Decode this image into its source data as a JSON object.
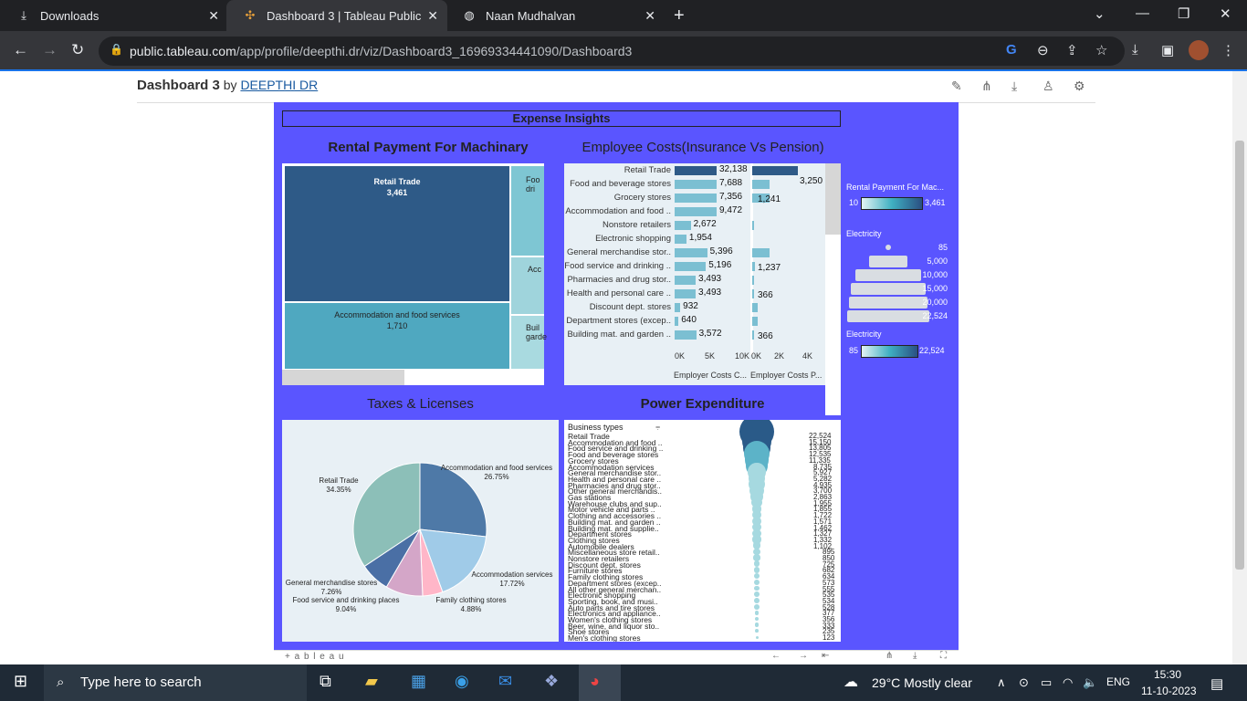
{
  "browser": {
    "tabs": [
      {
        "label": "Downloads",
        "icon": "download-icon"
      },
      {
        "label": "Dashboard 3 | Tableau Public",
        "icon": "tableau-icon"
      },
      {
        "label": "Naan Mudhalvan",
        "icon": "globe-icon"
      }
    ],
    "url_host": "public.tableau.com",
    "url_path": "/app/profile/deepthi.dr/viz/Dashboard3_16969334441090/Dashboard3"
  },
  "header": {
    "title": "Dashboard 3",
    "by": "by",
    "author": "DEEPTHI DR"
  },
  "dashboard": {
    "title": "Expense Insights",
    "rental": {
      "title": "Rental Payment For Machinary",
      "cells": [
        {
          "label": "Retail Trade",
          "value": "3,461"
        },
        {
          "label": "Accommodation and food services",
          "value": "1,710"
        },
        {
          "label": "Foo dri",
          "value": ""
        },
        {
          "label": "Acc",
          "value": ""
        },
        {
          "label": "Buil garde",
          "value": ""
        }
      ]
    },
    "employee": {
      "title": "Employee Costs(Insurance Vs Pension)",
      "rows": [
        {
          "label": "Retail Trade",
          "ins": 32138,
          "ins_label": "32,138",
          "pen": 3250,
          "pen_label": "3,250"
        },
        {
          "label": "Food and beverage stores",
          "ins": 7688,
          "ins_label": "7,688",
          "pen": 1241,
          "pen_label": ""
        },
        {
          "label": "Grocery stores",
          "ins": 7356,
          "ins_label": "7,356",
          "pen": 1241,
          "pen_label": "1,241"
        },
        {
          "label": "Accommodation and food ..",
          "ins": 9472,
          "ins_label": "9,472",
          "pen": 0,
          "pen_label": ""
        },
        {
          "label": "Nonstore retailers",
          "ins": 2672,
          "ins_label": "2,672",
          "pen": 100,
          "pen_label": ""
        },
        {
          "label": "Electronic shopping",
          "ins": 1954,
          "ins_label": "1,954",
          "pen": 0,
          "pen_label": ""
        },
        {
          "label": "General merchandise stor..",
          "ins": 5396,
          "ins_label": "5,396",
          "pen": 1237,
          "pen_label": ""
        },
        {
          "label": "Food service and drinking ..",
          "ins": 5196,
          "ins_label": "5,196",
          "pen": 200,
          "pen_label": "1,237"
        },
        {
          "label": "Pharmacies and drug stor..",
          "ins": 3493,
          "ins_label": "3,493",
          "pen": 150,
          "pen_label": ""
        },
        {
          "label": "Health and personal care ..",
          "ins": 3493,
          "ins_label": "3,493",
          "pen": 150,
          "pen_label": "366"
        },
        {
          "label": "Discount dept. stores",
          "ins": 932,
          "ins_label": "932",
          "pen": 366,
          "pen_label": ""
        },
        {
          "label": "Department stores (excep..",
          "ins": 640,
          "ins_label": "640",
          "pen": 366,
          "pen_label": ""
        },
        {
          "label": "Building mat. and garden ..",
          "ins": 3572,
          "ins_label": "3,572",
          "pen": 100,
          "pen_label": "366"
        }
      ],
      "axis1": [
        "0K",
        "5K",
        "10K"
      ],
      "axis2": [
        "0K",
        "2K",
        "4K"
      ],
      "xlabel1": "Employer Costs C...",
      "xlabel2": "Employer Costs P..."
    },
    "taxes": {
      "title": "Taxes & Licenses",
      "slices": [
        {
          "label": "Accommodation and food services",
          "pct": "26.75%",
          "value": 26.75,
          "color": "#4e79a7"
        },
        {
          "label": "Accommodation services",
          "pct": "17.72%",
          "value": 17.72,
          "color": "#a0cbe8"
        },
        {
          "label": "Family clothing stores",
          "pct": "4.88%",
          "value": 4.88,
          "color": "#ffb6c8"
        },
        {
          "label": "Food service and drinking places",
          "pct": "9.04%",
          "value": 9.04,
          "color": "#d4a6c8"
        },
        {
          "label": "General merchandise stores",
          "pct": "7.26%",
          "value": 7.26,
          "color": "#4a6fa5"
        },
        {
          "label": "Retail Trade",
          "pct": "34.35%",
          "value": 34.35,
          "color": "#8cbfb8"
        }
      ]
    },
    "power": {
      "title": "Power Expenditure",
      "header": "Business types",
      "rows": [
        "Retail Trade",
        "Accommodation and food ..",
        "Food service and drinking ..",
        "Food and beverage stores",
        "Grocery stores",
        "Accommodation services",
        "General merchandise stor..",
        "Health and personal care ..",
        "Pharmacies and drug stor..",
        "Other general merchandis..",
        "Gas stations",
        "Warehouse clubs and sup..",
        "Motor vehicle and parts ..",
        "Clothing and accessories ..",
        "Building mat. and garden ..",
        "Building mat. and supplie..",
        "Department stores",
        "Clothing stores",
        "Automobile dealers",
        "Miscellaneous store retail..",
        "Nonstore retailers",
        "Discount dept. stores",
        "Furniture stores",
        "Family clothing stores",
        "Department stores (excep..",
        "All other general merchan..",
        "Electronic shopping",
        "Sporting, book, and musi..",
        "Auto parts and tire stores",
        "Electronics and appliance..",
        "Women's clothing stores",
        "Beer, wine, and liquor sto..",
        "Shoe stores",
        "Men's clothing stores"
      ],
      "values": [
        22524,
        15150,
        13805,
        12535,
        11335,
        8735,
        5927,
        5282,
        4935,
        3700,
        2863,
        1955,
        1855,
        1722,
        1571,
        1462,
        1327,
        1332,
        1102,
        895,
        850,
        725,
        682,
        634,
        573,
        555,
        535,
        534,
        528,
        377,
        356,
        333,
        235,
        123
      ],
      "value_labels": [
        "22,524",
        "15,150",
        "13,805",
        "12,535",
        "11,335",
        "8,735",
        "5,927",
        "5,282",
        "4,935",
        "3,700",
        "2,863",
        "1,955",
        "1,855",
        "1,722",
        "1,571",
        "1,462",
        "1,327",
        "1,332",
        "1,102",
        "895",
        "850",
        "725",
        "682",
        "634",
        "573",
        "555",
        "535",
        "534",
        "528",
        "377",
        "356",
        "333",
        "235",
        "123"
      ]
    },
    "legend": {
      "rental_title": "Rental Payment For Mac...",
      "rental_min": "10",
      "rental_max": "3,461",
      "elec_title": "Electricity",
      "elec_values": [
        "85",
        "5,000",
        "10,000",
        "15,000",
        "20,000",
        "22,524"
      ],
      "elec2_title": "Electricity",
      "elec2_min": "85",
      "elec2_max": "22,524"
    },
    "footer": "+ a b l e a u"
  },
  "taskbar": {
    "search": "Type here to search",
    "weather": "29°C  Mostly clear",
    "lang": "ENG",
    "time": "15:30",
    "date": "11-10-2023"
  }
}
